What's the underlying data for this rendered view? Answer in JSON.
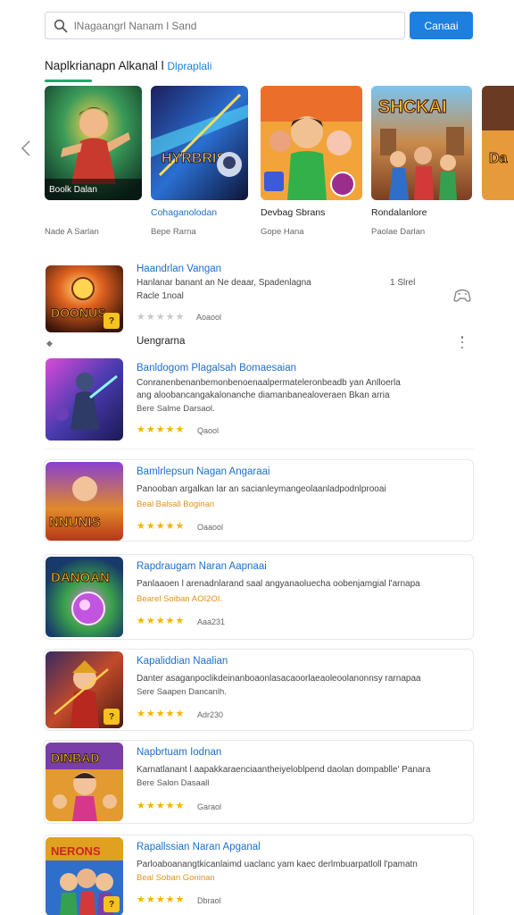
{
  "search": {
    "placeholder": "lNagaangrl Nanam l Sand",
    "button_label": "Canaai"
  },
  "section": {
    "title": "Naplkrianapn Alkanal l",
    "title_accent": "Dlpraplali"
  },
  "carousel": [
    {
      "name": "Boolk Dalan",
      "sub": "Nade A Sarlan"
    },
    {
      "name": "Cohaganolodan",
      "sub": "Bepe Rarna"
    },
    {
      "name": "Devbag Sbrans",
      "sub": "Gope Hana"
    },
    {
      "name": "Rondalanlore",
      "sub": "Paolae Darlan"
    }
  ],
  "featured": {
    "title": "Haandrlan Vangan",
    "desc": "Hanlanar banant an Ne deaar, Spadenlagna",
    "meta": "Racle 1noal",
    "count": "1 Slrel",
    "rating": "Aoaool",
    "subhead": "Uengrarna"
  },
  "games": [
    {
      "title": "Banldogom Plagalsah Bomaesaian",
      "desc1": "Conranenbenanbemonbenoenaalpermateleronbeadb yan Anlloerla",
      "desc2": "ang aloobancangakalonanche diamanbanealoveraen Bkan arria",
      "meta": "Bere Salme Darsaol.",
      "rating": "Qaool"
    },
    {
      "title": "Bamlrlepsun Nagan Angaraai",
      "desc1": "Panooban argalkan lar an sacianleymangeolaanladpodnlprooai",
      "meta": "Beal Balsall Boginan",
      "rating": "Oaaool"
    },
    {
      "title": "Rapdraugam Naran Aapnaai",
      "desc1": "Panlaaoen l arenadnlarand saal angyanaoluecha oobenjamgial l'arnapa",
      "meta": "Bearel Soiban AOI2OI.",
      "rating": "Aaa231"
    },
    {
      "title": "Kapaliddian Naalian",
      "desc1": "Danter asaganpoclikdeinanboaonlasacaoorlaeaoleoolanonnsy rarnapaa",
      "meta": "Sere Saapen Dancanlh.",
      "rating": "Adr230"
    },
    {
      "title": "Napbrtuam Iodnan",
      "desc1": "Karnatlanant l aapakkaraenciaantheiyeloblpend daolan dompablle' Panara",
      "meta": "Bere Salon Dasaall",
      "rating": "Garaol"
    },
    {
      "title": "Rapallssian Naran Apganal",
      "desc1": "Parloaboanangtkicanlaimd uaclanc yam kaec derlmbuarpatloll l'pamatn",
      "meta": "Beal Soban Goninan",
      "rating": "Dbraol"
    }
  ],
  "stars_filled": "★★★★★",
  "stars_empty": "★★★★★",
  "colors": {
    "accent": "#1d7fe0",
    "link": "#1d6fc9",
    "star": "#f4b400",
    "underline": "#22a86b"
  }
}
